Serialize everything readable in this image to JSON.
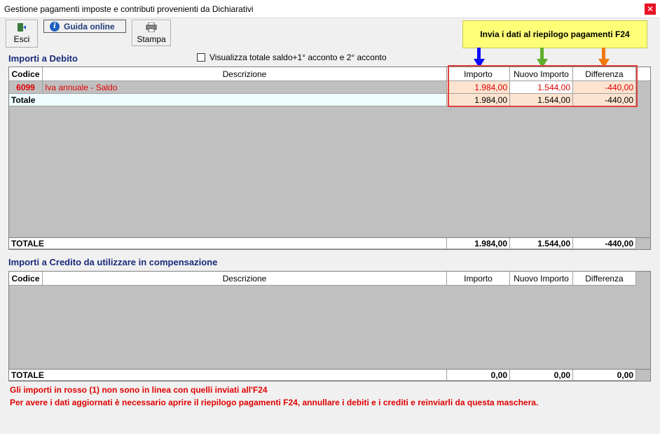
{
  "window": {
    "title": "Gestione pagamenti imposte e contributi provenienti da Dichiarativi",
    "close": "✕"
  },
  "toolbar": {
    "exit_label": "Esci",
    "guide_label": "Guida online",
    "print_label": "Stampa",
    "send_label": "Invia i dati al riepilogo pagamenti F24"
  },
  "debit": {
    "title": "Importi a Debito",
    "checkbox_label": "Visualizza totale saldo+1° acconto e 2° acconto",
    "headers": {
      "code": "Codice",
      "desc": "Descrizione",
      "amount": "Importo",
      "new_amount": "Nuovo Importo",
      "diff": "Differenza"
    },
    "rows": [
      {
        "code": "6099",
        "desc": "Iva annuale - Saldo",
        "amount": "1.984,00",
        "new_amount": "1.544,00",
        "diff": "-440,00"
      }
    ],
    "subtotal": {
      "label": "Totale",
      "amount": "1.984,00",
      "new_amount": "1.544,00",
      "diff": "-440,00"
    },
    "total": {
      "label": "TOTALE",
      "amount": "1.984,00",
      "new_amount": "1.544,00",
      "diff": "-440,00"
    }
  },
  "credit": {
    "title": "Importi a Credito da utilizzare in compensazione",
    "headers": {
      "code": "Codice",
      "desc": "Descrizione",
      "amount": "Importo",
      "new_amount": "Nuovo Importo",
      "diff": "Differenza"
    },
    "total": {
      "label": "TOTALE",
      "amount": "0,00",
      "new_amount": "0,00",
      "diff": "0,00"
    }
  },
  "notes": {
    "line1": "Gli importi in rosso (1) non sono in linea con quelli inviati all'F24",
    "line2": "Per avere i dati aggiornati è necessario aprire il riepilogo pagamenti F24, annullare i debiti e i crediti e reinviarli da questa maschera."
  },
  "colors": {
    "blue_arrow": "#0a0aff",
    "green_arrow": "#5fae2e",
    "orange_arrow": "#f07a10",
    "highlight": "#e04040",
    "row_salmon": "#fde4d0"
  }
}
